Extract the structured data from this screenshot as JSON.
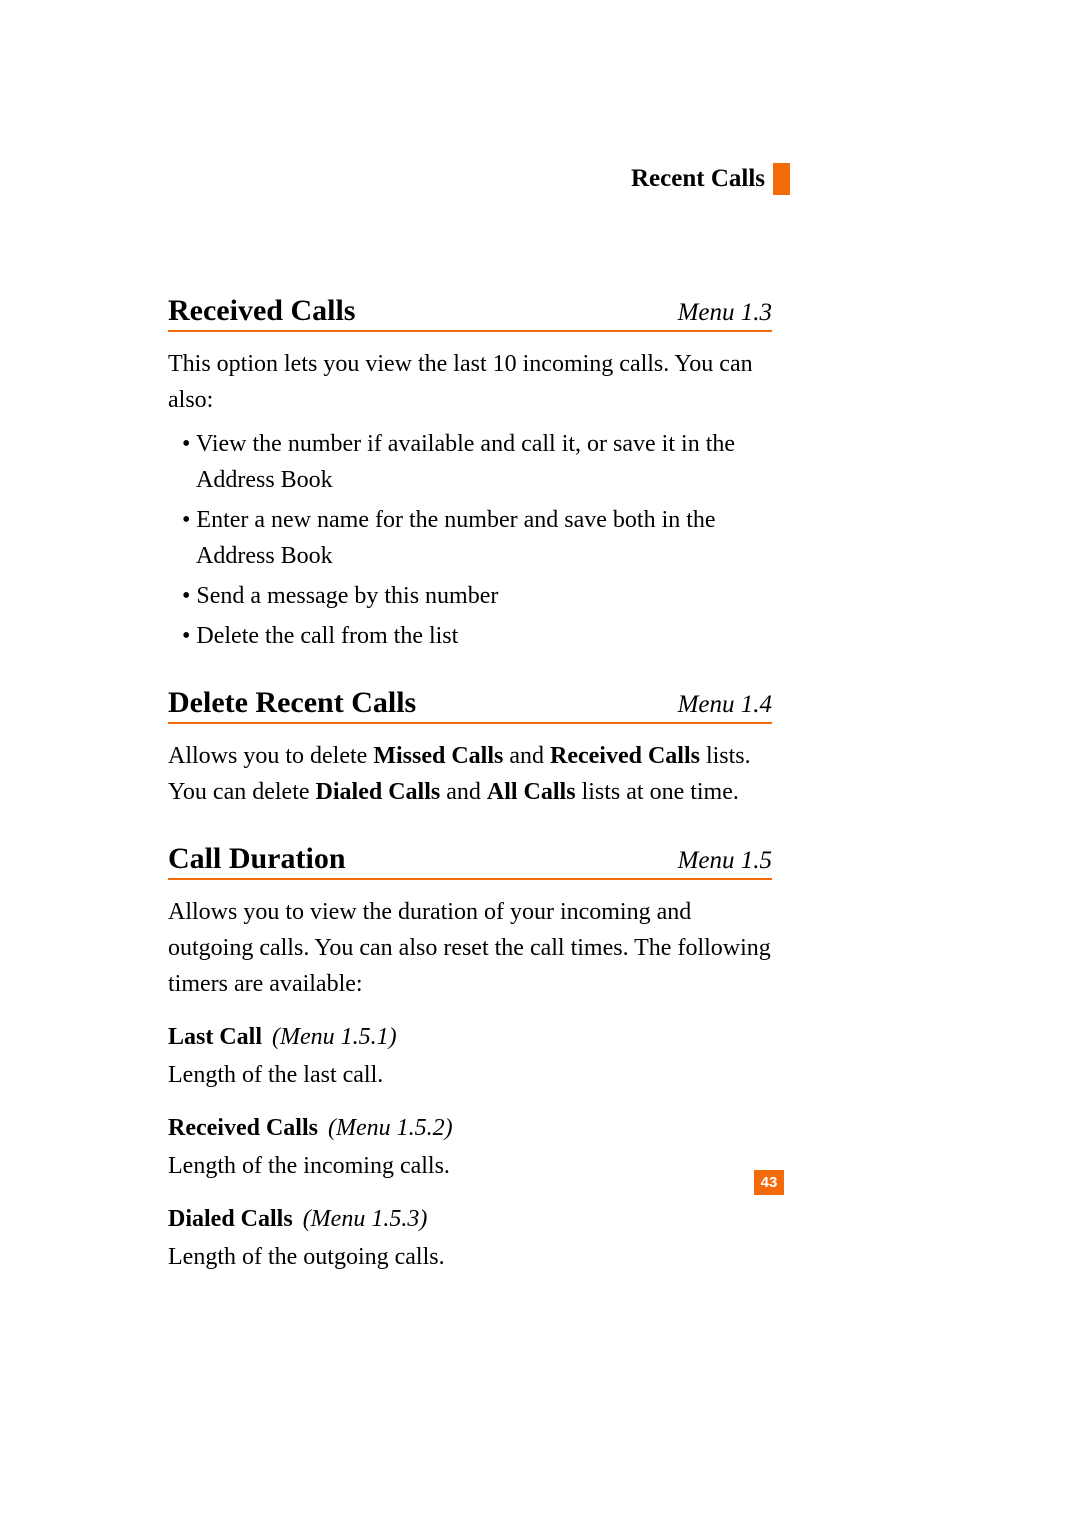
{
  "header": {
    "title": "Recent Calls"
  },
  "sections": [
    {
      "title": "Received Calls",
      "menu": "Menu 1.3",
      "intro": "This option lets you view the last 10 incoming calls. You can also:",
      "bullets": [
        "View the number if available and call it, or save it in the Address Book",
        "Enter a new name for the number and save both in the Address Book",
        "Send a message by this number",
        "Delete the call from the list"
      ]
    },
    {
      "title": "Delete Recent Calls",
      "menu": "Menu 1.4",
      "para_runs": [
        {
          "text": "Allows you to delete ",
          "bold": false
        },
        {
          "text": "Missed Calls",
          "bold": true
        },
        {
          "text": " and ",
          "bold": false
        },
        {
          "text": "Received Calls",
          "bold": true
        },
        {
          "text": " lists. You can delete ",
          "bold": false
        },
        {
          "text": "Dialed Calls",
          "bold": true
        },
        {
          "text": " and ",
          "bold": false
        },
        {
          "text": "All Calls",
          "bold": true
        },
        {
          "text": " lists at one time.",
          "bold": false
        }
      ]
    },
    {
      "title": "Call Duration",
      "menu": "Menu 1.5",
      "intro": "Allows you to view the duration of your incoming and outgoing calls. You can also reset the call times. The following timers are available:",
      "subsections": [
        {
          "title": "Last Call",
          "menu": "(Menu 1.5.1)",
          "text": "Length of the last call."
        },
        {
          "title": "Received Calls",
          "menu": "(Menu 1.5.2)",
          "text": "Length of the incoming calls."
        },
        {
          "title": "Dialed Calls",
          "menu": "(Menu 1.5.3)",
          "text": "Length of the outgoing calls."
        }
      ]
    }
  ],
  "page_number": "43"
}
